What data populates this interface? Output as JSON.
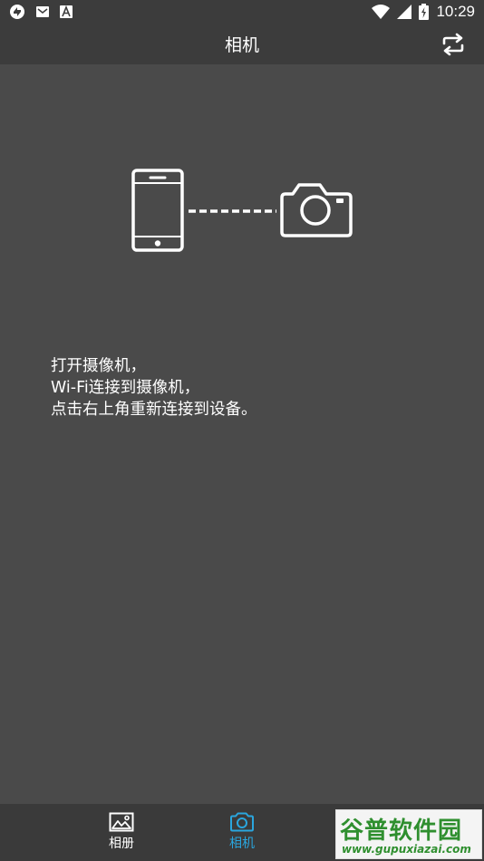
{
  "status_bar": {
    "time": "10:29",
    "left_icons": [
      "sync-icon",
      "mail-icon",
      "text-a-icon"
    ],
    "right_icons": [
      "wifi-icon",
      "cellular-signal-icon",
      "battery-charging-icon"
    ]
  },
  "app_bar": {
    "title": "相机",
    "action_icon": "switch-camera-icon"
  },
  "illustration": {
    "icons": [
      "phone-icon",
      "dashed-connection-line",
      "camera-icon"
    ]
  },
  "instructions": {
    "line1": "打开摄像机，",
    "line2": "Wi-Fi连接到摄像机，",
    "line3": "点击右上角重新连接到设备。"
  },
  "bottom_nav": {
    "items": [
      {
        "label": "相册",
        "icon": "album-icon",
        "active": false
      },
      {
        "label": "相机",
        "icon": "camera-icon",
        "active": true
      }
    ]
  },
  "watermark": {
    "title": "谷普软件园",
    "url": "www.gupuxiazai.com"
  },
  "colors": {
    "background": "#4a4a4a",
    "bar": "#3c3c3c",
    "nav_background": "#3a3a3a",
    "accent": "#2aa6de",
    "watermark_green": "#2f8f2f"
  }
}
